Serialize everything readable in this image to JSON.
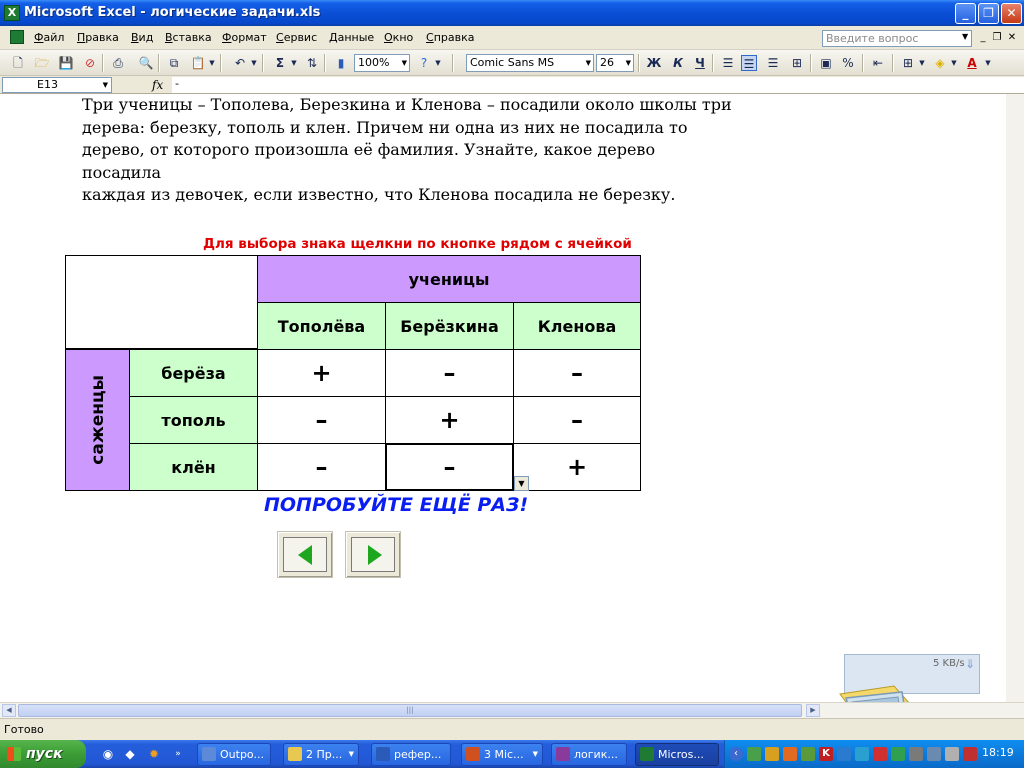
{
  "window": {
    "title": "Microsoft Excel - логические задачи.xls",
    "app_icon": "excel-icon",
    "buttons": {
      "minimize": "_",
      "restore": "❐",
      "close": "✕"
    }
  },
  "menu": {
    "items": [
      "Файл",
      "Правка",
      "Вид",
      "Вставка",
      "Формат",
      "Сервис",
      "Данные",
      "Окно",
      "Справка"
    ],
    "ask_placeholder": "Введите вопрос",
    "mdi_buttons": {
      "minimize": "_",
      "restore": "❐",
      "close": "✕"
    }
  },
  "toolbar": {
    "zoom": "100%",
    "font_name": "Comic Sans MS",
    "font_size": "26",
    "bold": "Ж",
    "italic": "К",
    "underline": "Ч",
    "sum": "Σ",
    "percent": "%",
    "font_color_letter": "A"
  },
  "formula_bar": {
    "name_box": "E13",
    "fx": "fx",
    "formula": "-"
  },
  "sheet": {
    "task_lines": [
      "Три ученицы – Тополева, Березкина и Кленова – посадили около школы три",
      "дерева:  березку, тополь и клен. Причем ни одна из них не посадила то",
      "дерево, от которого произошла её фамилия. Узнайте, какое дерево посадила",
      "каждая из девочек, если известно, что Кленова посадила не березку."
    ],
    "hint": "Для выбора знака щелкни по кнопке рядом с ячейкой",
    "table": {
      "students_header": "ученицы",
      "trees_header": "саженцы",
      "students": [
        "Тополёва",
        "Берёзкина",
        "Кленова"
      ],
      "trees": [
        "берёза",
        "тополь",
        "клён"
      ],
      "marks": [
        [
          "+",
          "–",
          "–"
        ],
        [
          "–",
          "+",
          "–"
        ],
        [
          "–",
          "–",
          "+"
        ]
      ]
    },
    "result_message": "ПОПРОБУЙТЕ ЕЩЁ РАЗ!"
  },
  "colors": {
    "header_purple": "#cc99ff",
    "label_green": "#ccffcc",
    "hint_red": "#e00000",
    "message_blue": "#0a1ef2"
  },
  "netmeter": {
    "rate": "5 KB/s"
  },
  "status": {
    "text": "Готово"
  },
  "taskbar": {
    "start": "пуск",
    "tasks": [
      "Outpo...",
      "2 Пр...",
      "рефер...",
      "3 Mic...",
      "логик...",
      "Micros..."
    ],
    "clock": "18:19"
  }
}
